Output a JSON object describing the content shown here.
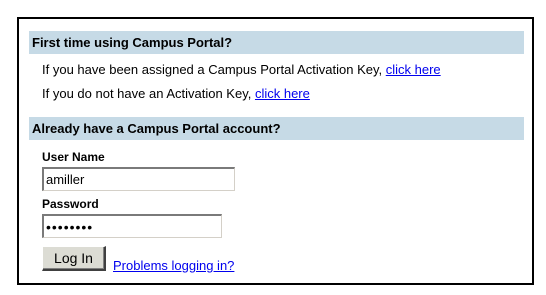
{
  "sections": {
    "first_time": {
      "title": "First time using Campus Portal?",
      "line1_text": "If you have been assigned a Campus Portal Activation Key, ",
      "line1_link": "click here",
      "line2_text": "If you do not have an Activation Key, ",
      "line2_link": "click here"
    },
    "existing": {
      "title": "Already have a Campus Portal account?"
    }
  },
  "login": {
    "username_label": "User Name",
    "username_value": "amiller",
    "password_label": "Password",
    "password_value": "amiller1",
    "login_button": "Log In",
    "problems_link": "Problems logging in?"
  },
  "colors": {
    "header_bg": "#c6dae6",
    "link": "#0000ee",
    "border": "#000000"
  }
}
